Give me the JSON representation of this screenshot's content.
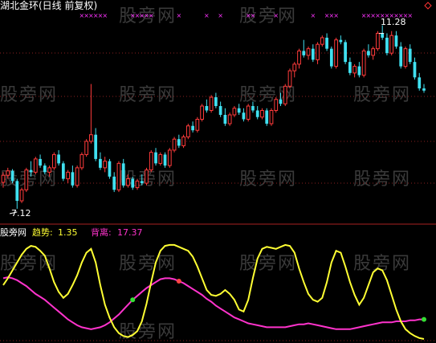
{
  "main_chart": {
    "title": "湖北金环(日线 前复权)",
    "high_label": "11.28",
    "low_label": "7.12",
    "high_price": 11.28,
    "low_price": 7.12,
    "corner_icon": "diamond-icon",
    "up_color": "#ff3b3b",
    "down_color": "#40e0f0",
    "signal_color": "#ff33ff",
    "candles": [
      [
        7.72,
        7.95,
        7.6,
        7.88
      ],
      [
        7.88,
        8.05,
        7.8,
        7.98
      ],
      [
        7.98,
        8.02,
        7.7,
        7.75
      ],
      [
        7.75,
        7.8,
        7.12,
        7.3
      ],
      [
        7.3,
        7.6,
        7.25,
        7.55
      ],
      [
        7.55,
        8.05,
        7.5,
        8.0
      ],
      [
        8.0,
        8.2,
        7.85,
        7.95
      ],
      [
        7.95,
        8.3,
        7.9,
        8.25
      ],
      [
        8.25,
        8.35,
        8.05,
        8.1
      ],
      [
        8.1,
        8.15,
        7.9,
        7.95
      ],
      [
        7.95,
        8.1,
        7.85,
        8.05
      ],
      [
        8.05,
        8.4,
        8.0,
        8.35
      ],
      [
        8.35,
        8.45,
        8.1,
        8.15
      ],
      [
        8.15,
        8.2,
        7.75,
        7.8
      ],
      [
        7.8,
        8.0,
        7.7,
        7.95
      ],
      [
        7.95,
        8.1,
        7.6,
        7.65
      ],
      [
        7.65,
        8.1,
        7.6,
        8.05
      ],
      [
        8.05,
        8.4,
        8.0,
        8.35
      ],
      [
        8.35,
        8.7,
        8.3,
        8.65
      ],
      [
        8.65,
        9.95,
        8.6,
        8.8
      ],
      [
        8.8,
        8.95,
        8.2,
        8.25
      ],
      [
        8.25,
        8.4,
        8.0,
        8.05
      ],
      [
        8.05,
        8.3,
        7.95,
        8.2
      ],
      [
        8.2,
        8.25,
        7.8,
        7.85
      ],
      [
        7.85,
        7.95,
        7.5,
        7.55
      ],
      [
        7.55,
        8.2,
        7.5,
        8.15
      ],
      [
        8.15,
        8.25,
        7.6,
        7.65
      ],
      [
        7.65,
        7.9,
        7.6,
        7.8
      ],
      [
        7.8,
        7.85,
        7.55,
        7.6
      ],
      [
        7.6,
        7.8,
        7.55,
        7.75
      ],
      [
        7.75,
        7.9,
        7.65,
        7.7
      ],
      [
        7.7,
        8.05,
        7.65,
        8.0
      ],
      [
        8.0,
        8.45,
        7.95,
        8.4
      ],
      [
        8.4,
        8.5,
        8.1,
        8.15
      ],
      [
        8.15,
        8.4,
        8.1,
        8.35
      ],
      [
        8.35,
        8.4,
        8.05,
        8.1
      ],
      [
        8.1,
        8.5,
        8.05,
        8.45
      ],
      [
        8.45,
        8.75,
        8.4,
        8.7
      ],
      [
        8.7,
        8.8,
        8.5,
        8.55
      ],
      [
        8.55,
        8.8,
        8.5,
        8.75
      ],
      [
        8.75,
        9.05,
        8.7,
        9.0
      ],
      [
        9.0,
        9.1,
        8.85,
        8.9
      ],
      [
        8.9,
        9.2,
        8.85,
        9.15
      ],
      [
        9.15,
        9.5,
        9.1,
        9.45
      ],
      [
        9.45,
        9.6,
        9.3,
        9.35
      ],
      [
        9.35,
        9.7,
        9.3,
        9.65
      ],
      [
        9.65,
        9.75,
        9.4,
        9.45
      ],
      [
        9.45,
        9.55,
        9.2,
        9.25
      ],
      [
        9.25,
        9.4,
        9.0,
        9.05
      ],
      [
        9.05,
        9.3,
        9.0,
        9.25
      ],
      [
        9.25,
        9.45,
        9.2,
        9.4
      ],
      [
        9.4,
        9.5,
        9.25,
        9.3
      ],
      [
        9.3,
        9.4,
        9.1,
        9.15
      ],
      [
        9.15,
        9.5,
        9.1,
        9.45
      ],
      [
        9.45,
        9.55,
        9.3,
        9.35
      ],
      [
        9.35,
        9.45,
        9.15,
        9.2
      ],
      [
        9.2,
        9.4,
        9.15,
        9.35
      ],
      [
        9.35,
        9.4,
        9.0,
        9.05
      ],
      [
        9.05,
        9.4,
        9.0,
        9.35
      ],
      [
        9.35,
        9.65,
        9.3,
        9.6
      ],
      [
        9.6,
        9.75,
        9.45,
        9.5
      ],
      [
        9.5,
        9.95,
        9.45,
        9.9
      ],
      [
        9.9,
        10.3,
        9.85,
        10.25
      ],
      [
        10.25,
        10.45,
        10.1,
        10.4
      ],
      [
        10.4,
        10.75,
        10.3,
        10.7
      ],
      [
        10.7,
        10.95,
        10.55,
        10.6
      ],
      [
        10.6,
        10.8,
        10.5,
        10.75
      ],
      [
        10.75,
        10.85,
        10.45,
        10.5
      ],
      [
        10.5,
        10.9,
        10.4,
        10.85
      ],
      [
        10.85,
        11.05,
        10.8,
        11.0
      ],
      [
        11.0,
        11.1,
        10.7,
        10.75
      ],
      [
        10.75,
        10.8,
        10.3,
        10.35
      ],
      [
        10.35,
        11.0,
        10.3,
        10.95
      ],
      [
        10.95,
        11.05,
        10.85,
        10.9
      ],
      [
        10.9,
        10.95,
        10.4,
        10.45
      ],
      [
        10.45,
        10.55,
        10.15,
        10.2
      ],
      [
        10.2,
        10.4,
        10.1,
        10.35
      ],
      [
        10.35,
        10.45,
        10.1,
        10.15
      ],
      [
        10.15,
        10.75,
        10.1,
        10.7
      ],
      [
        10.7,
        10.85,
        10.55,
        10.6
      ],
      [
        10.6,
        10.8,
        10.5,
        10.75
      ],
      [
        10.75,
        11.15,
        10.7,
        11.1
      ],
      [
        11.1,
        11.28,
        10.95,
        11.0
      ],
      [
        11.0,
        11.1,
        10.6,
        10.65
      ],
      [
        10.65,
        11.15,
        10.6,
        11.05
      ],
      [
        11.05,
        11.15,
        10.75,
        10.8
      ],
      [
        10.8,
        10.9,
        10.3,
        10.35
      ],
      [
        10.35,
        10.8,
        10.3,
        10.75
      ],
      [
        10.75,
        10.85,
        10.4,
        10.45
      ],
      [
        10.45,
        10.55,
        10.05,
        10.1
      ],
      [
        10.1,
        10.2,
        9.8,
        9.85
      ],
      [
        9.85,
        9.95,
        9.75,
        9.8
      ]
    ],
    "signal_bars": [
      17,
      18,
      19,
      20,
      21,
      22,
      28,
      29,
      30,
      31,
      32,
      38,
      44,
      47,
      53,
      54,
      59,
      67,
      70,
      71,
      72,
      78,
      79,
      80,
      81,
      82,
      83,
      84,
      85,
      86,
      87,
      88
    ]
  },
  "indicator": {
    "name_label": "股旁网",
    "trend_label": "趋势:",
    "trend_value": "1.35",
    "deviation_label": "背离:",
    "deviation_value": "17.37",
    "trend_color": "#ffff33",
    "deviation_color": "#ff33cc",
    "cross_up_color": "#33dd33",
    "cross_down_color": "#ff4444",
    "trend_series": [
      55,
      62,
      70,
      78,
      86,
      92,
      95,
      94,
      90,
      85,
      72,
      58,
      48,
      42,
      46,
      55,
      65,
      78,
      88,
      92,
      78,
      55,
      35,
      22,
      12,
      6,
      3,
      2,
      4,
      8,
      18,
      36,
      58,
      78,
      90,
      95,
      96,
      96,
      94,
      92,
      90,
      84,
      74,
      62,
      50,
      45,
      44,
      46,
      50,
      46,
      40,
      30,
      28,
      40,
      62,
      82,
      92,
      94,
      93,
      92,
      94,
      96,
      95,
      88,
      72,
      58,
      46,
      40,
      38,
      42,
      58,
      78,
      90,
      88,
      74,
      58,
      45,
      35,
      42,
      55,
      68,
      72,
      70,
      60,
      45,
      30,
      18,
      10,
      6,
      3,
      1,
      0
    ],
    "deviation_series": [
      62,
      63,
      62,
      60,
      57,
      54,
      50,
      46,
      43,
      40,
      36,
      32,
      28,
      24,
      20,
      17,
      14,
      12,
      11,
      10,
      11,
      12,
      14,
      17,
      21,
      25,
      30,
      35,
      40,
      44,
      48,
      52,
      55,
      58,
      61,
      62,
      62,
      61,
      59,
      57,
      54,
      51,
      48,
      45,
      41,
      38,
      34,
      31,
      28,
      25,
      22,
      20,
      18,
      16,
      15,
      14,
      13,
      12,
      12,
      12,
      12,
      12,
      13,
      14,
      15,
      15,
      16,
      15,
      14,
      13,
      12,
      11,
      10,
      10,
      10,
      10,
      11,
      12,
      13,
      14,
      15,
      16,
      17,
      17,
      17,
      18,
      18,
      18,
      19,
      19,
      20,
      20
    ],
    "cross_points": [
      {
        "bar": 28,
        "direction": "up"
      },
      {
        "bar": 38,
        "direction": "down"
      },
      {
        "bar": 91,
        "direction": "up"
      }
    ]
  },
  "watermarks": [
    "股旁网",
    "股旁网",
    "股旁网",
    "股旁网",
    "股旁网",
    "股旁网",
    "股旁网",
    "股旁网",
    "股旁网",
    "股旁网",
    "股旁网",
    "股旁网",
    "股旁网",
    "股旁网",
    "股旁网"
  ]
}
